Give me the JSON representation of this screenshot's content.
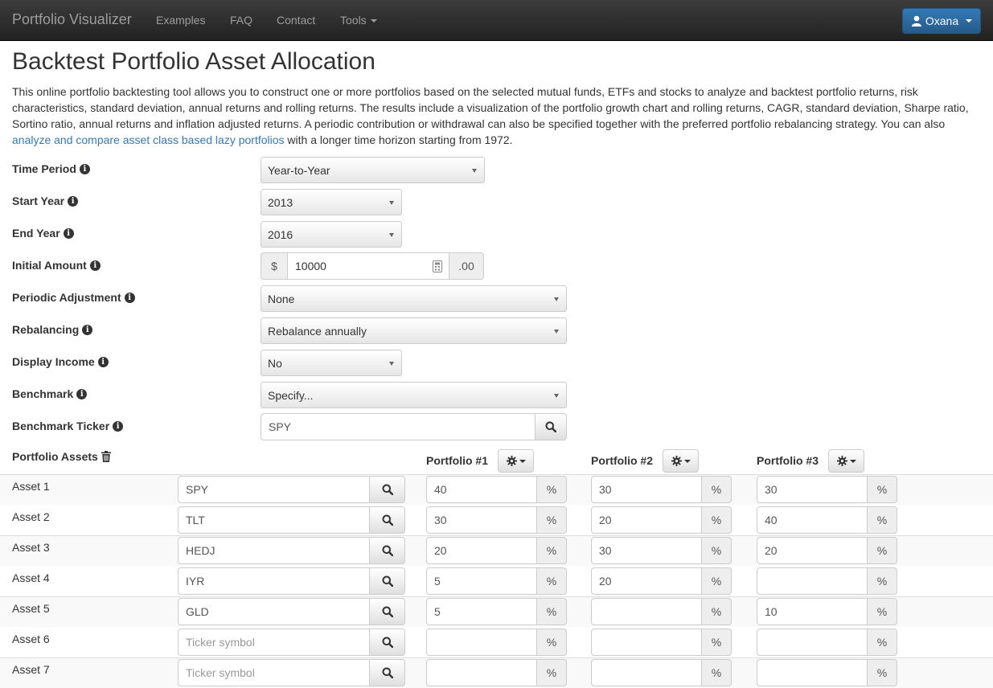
{
  "navbar": {
    "brand": "Portfolio Visualizer",
    "links": [
      "Examples",
      "FAQ",
      "Contact",
      "Tools"
    ],
    "user": "Oxana"
  },
  "page": {
    "title": "Backtest Portfolio Asset Allocation",
    "intro_text": "This online portfolio backtesting tool allows you to construct one or more portfolios based on the selected mutual funds, ETFs and stocks to analyze and backtest portfolio returns, risk characteristics, standard deviation, annual returns and rolling returns. The results include a visualization of the portfolio growth chart and rolling returns, CAGR, standard deviation, Sharpe ratio, Sortino ratio, annual returns and inflation adjusted returns. A periodic contribution or withdrawal can also be specified together with the preferred portfolio rebalancing strategy. You can also ",
    "intro_link": "analyze and compare asset class based lazy portfolios",
    "intro_tail": " with a longer time horizon starting from 1972."
  },
  "form": {
    "time_period": {
      "label": "Time Period",
      "value": "Year-to-Year"
    },
    "start_year": {
      "label": "Start Year",
      "value": "2013"
    },
    "end_year": {
      "label": "End Year",
      "value": "2016"
    },
    "initial_amount": {
      "label": "Initial Amount",
      "prefix": "$",
      "value": "10000",
      "suffix": ".00"
    },
    "periodic_adjustment": {
      "label": "Periodic Adjustment",
      "value": "None"
    },
    "rebalancing": {
      "label": "Rebalancing",
      "value": "Rebalance annually"
    },
    "display_income": {
      "label": "Display Income",
      "value": "No"
    },
    "benchmark": {
      "label": "Benchmark",
      "value": "Specify..."
    },
    "benchmark_ticker": {
      "label": "Benchmark Ticker",
      "value": "SPY"
    }
  },
  "assets": {
    "header": "Portfolio Assets",
    "portfolio_headers": [
      "Portfolio #1",
      "Portfolio #2",
      "Portfolio #3"
    ],
    "percent_symbol": "%",
    "ticker_placeholder": "Ticker symbol",
    "rows": [
      {
        "label": "Asset 1",
        "ticker": "SPY",
        "p1": "40",
        "p2": "30",
        "p3": "30"
      },
      {
        "label": "Asset 2",
        "ticker": "TLT",
        "p1": "30",
        "p2": "20",
        "p3": "40"
      },
      {
        "label": "Asset 3",
        "ticker": "HEDJ",
        "p1": "20",
        "p2": "30",
        "p3": "20"
      },
      {
        "label": "Asset 4",
        "ticker": "IYR",
        "p1": "5",
        "p2": "20",
        "p3": ""
      },
      {
        "label": "Asset 5",
        "ticker": "GLD",
        "p1": "5",
        "p2": "",
        "p3": "10"
      },
      {
        "label": "Asset 6",
        "ticker": "",
        "p1": "",
        "p2": "",
        "p3": ""
      },
      {
        "label": "Asset 7",
        "ticker": "",
        "p1": "",
        "p2": "",
        "p3": ""
      }
    ]
  },
  "icons": {
    "info": "info-icon",
    "search": "search-icon",
    "gear": "gear-icon",
    "trash": "trash-icon",
    "user": "user-icon"
  },
  "colors": {
    "navbar": "#222222",
    "primary": "#337ab7",
    "link": "#337ab7"
  }
}
